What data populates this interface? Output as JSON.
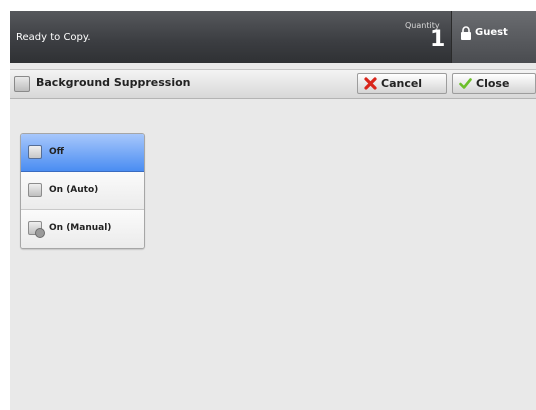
{
  "status_bar": {
    "message": "Ready to Copy.",
    "quantity_label": "Quantity",
    "quantity_value": "1",
    "user_label": "Guest",
    "user_icon": "lock-icon"
  },
  "title_bar": {
    "title": "Background Suppression",
    "cancel_label": "Cancel",
    "cancel_icon": "x-icon",
    "close_label": "Close",
    "close_icon": "checkmark-icon"
  },
  "options": {
    "selected": "Off",
    "items": [
      {
        "label": "Off"
      },
      {
        "label": "On (Auto)"
      },
      {
        "label": "On (Manual)"
      }
    ]
  },
  "colors": {
    "selected_option": "#4a8df2",
    "cancel_icon": "#d9261c",
    "close_icon": "#6bbf2a"
  }
}
